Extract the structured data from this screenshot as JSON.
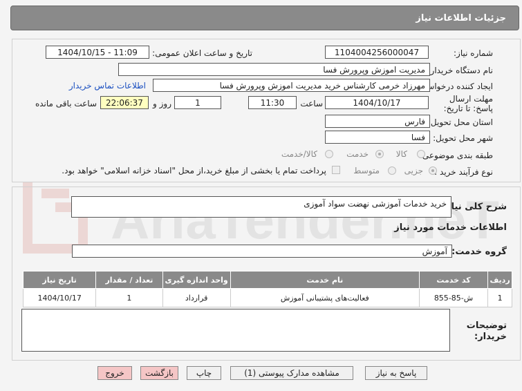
{
  "header": {
    "title": "جزئیات اطلاعات نیاز"
  },
  "form": {
    "need_number_label": "شماره نیاز:",
    "need_number": "1104004256000047",
    "announce_label": "تاریخ و ساعت اعلان عمومی:",
    "announce_value": "1404/10/15 - 11:09",
    "buyer_org_label": "نام دستگاه خریدار:",
    "buyer_org": "مدیریت اموزش وپرورش فسا",
    "creator_label": "ایجاد کننده درخواست:",
    "creator": "مهرزاد خرمی کارشناس خرید مدیریت اموزش وپرورش فسا",
    "contact_link": "اطلاعات تماس خریدار",
    "deadline_label": "مهلت ارسال پاسخ: تا تاریخ:",
    "deadline_date": "1404/10/17",
    "time_label": "ساعت",
    "deadline_time": "11:30",
    "days_value": "1",
    "days_label": "روز و",
    "remaining_time": "22:06:37",
    "remaining_label": "ساعت باقی مانده",
    "province_label": "استان محل تحویل:",
    "province": "فارس",
    "city_label": "شهر محل تحویل:",
    "city": "فسا",
    "category_label": "طبقه بندی موضوعی:",
    "category_options": [
      "کالا",
      "خدمت",
      "کالا/خدمت"
    ],
    "process_label": "نوع فرآیند خرید :",
    "process_options": [
      "جزیی",
      "متوسط"
    ],
    "payment_note": "پرداخت تمام یا بخشی از مبلغ خرید،از محل \"اسناد خزانه اسلامی\" خواهد بود."
  },
  "summary": {
    "label": "شرح کلی نیاز:",
    "value": "خرید خدمات آموزشی نهضت سواد آموزی"
  },
  "services": {
    "heading": "اطلاعات خدمات مورد نیاز",
    "group_label": "گروه خدمت:",
    "group_value": "آموزش",
    "columns": [
      "ردیف",
      "کد خدمت",
      "نام خدمت",
      "واحد اندازه گیری",
      "تعداد / مقدار",
      "تاریخ نیاز"
    ],
    "rows": [
      [
        "1",
        "ش-85-855",
        "فعالیت‌های پشتیبانی آموزش",
        "قرارداد",
        "1",
        "1404/10/17"
      ]
    ]
  },
  "notes": {
    "label": "توضیحات خریدار:"
  },
  "buttons": {
    "reply": "پاسخ به نیاز",
    "view_docs": "مشاهده مدارک پیوستی (1)",
    "print": "چاپ",
    "back": "بازگشت",
    "exit": "خروج"
  },
  "watermark": {
    "text": "AriaTender.neT"
  }
}
